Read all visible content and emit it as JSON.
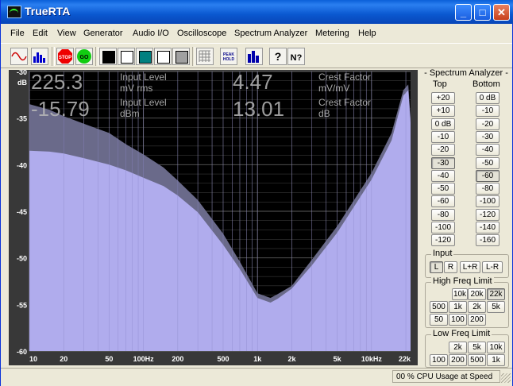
{
  "window": {
    "title": "TrueRTA"
  },
  "menu": [
    "File",
    "Edit",
    "View",
    "Generator",
    "Audio I/O",
    "Oscilloscope",
    "Spectrum Analyzer",
    "Metering",
    "Help"
  ],
  "toolbar": {
    "icons": [
      "sine-wave-icon",
      "spectrum-icon",
      "stop-icon",
      "go-icon",
      "black-swatch-icon",
      "white-swatch-icon",
      "teal-swatch-icon",
      "white-swatch-2-icon",
      "gray-swatch-icon",
      "grid-icon",
      "peak-hold-icon",
      "bars-icon",
      "help-icon",
      "context-help-icon"
    ],
    "stop_label": "STOP",
    "go_label": "GO",
    "peak_label_1": "PEAK",
    "peak_label_2": "HOLD",
    "help_label": "?",
    "context_help_label": "N?",
    "swatch_colors": [
      "#000000",
      "#ffffff",
      "#008080",
      "#ffffff",
      "#a0a0a0"
    ]
  },
  "readouts": {
    "input_level_mv": "225.3",
    "input_level_label1": "Input Level",
    "input_level_unit1": "mV rms",
    "input_level_dbm": "-15.79",
    "input_level_label2": "Input Level",
    "input_level_unit2": "dBm",
    "crest_ratio": "4.47",
    "crest_label1": "Crest Factor",
    "crest_unit1": "mV/mV",
    "crest_db": "13.01",
    "crest_label2": "Crest Factor",
    "crest_unit2": "dB"
  },
  "chart_data": {
    "type": "area",
    "title": "",
    "xlabel": "",
    "ylabel": "dB",
    "x_scale": "log",
    "xlim": [
      10,
      22000
    ],
    "ylim": [
      -60,
      -30
    ],
    "x_ticks": [
      "10",
      "20",
      "50",
      "100Hz",
      "200",
      "500",
      "1k",
      "2k",
      "5k",
      "10kHz",
      "22k"
    ],
    "x_tick_values": [
      10,
      20,
      50,
      100,
      200,
      500,
      1000,
      2000,
      5000,
      10000,
      22000
    ],
    "y_ticks": [
      "-30",
      "-35",
      "-40",
      "-45",
      "-50",
      "-55",
      "-60"
    ],
    "y_tick_values": [
      -30,
      -35,
      -40,
      -45,
      -50,
      -55,
      -60
    ],
    "series": [
      {
        "name": "",
        "color": "#b4b0f2",
        "x": [
          10,
          15,
          20,
          30,
          50,
          70,
          100,
          150,
          200,
          300,
          500,
          700,
          1000,
          1300,
          1500,
          2000,
          3000,
          5000,
          10000,
          15000,
          19000,
          21000,
          22000
        ],
        "y": [
          -38.5,
          -38.6,
          -38.8,
          -39.3,
          -40.0,
          -40.6,
          -41.4,
          -42.3,
          -43.3,
          -45.1,
          -48.6,
          -51.2,
          -54.3,
          -54.8,
          -54.4,
          -53.3,
          -50.8,
          -47.3,
          -41.6,
          -37.4,
          -32.6,
          -32.0,
          -35.5
        ]
      },
      {
        "name": "",
        "color": "#6a6a8a",
        "x": [
          10,
          15,
          20,
          30,
          50,
          70,
          100,
          150,
          200,
          300,
          500,
          700,
          1000,
          1300,
          1500,
          2000,
          3000,
          5000,
          10000,
          15000,
          19000,
          21000,
          22000
        ],
        "y": [
          -33.5,
          -34.1,
          -34.8,
          -35.6,
          -36.6,
          -37.8,
          -38.9,
          -40.3,
          -41.7,
          -43.8,
          -47.4,
          -50.4,
          -53.8,
          -54.3,
          -53.9,
          -53.0,
          -50.2,
          -46.6,
          -40.9,
          -36.6,
          -32.0,
          -31.4,
          -35.0
        ]
      }
    ],
    "grid": true,
    "background": "#000000",
    "grid_color": "#808080"
  },
  "right_panel": {
    "title": "- Spectrum Analyzer -",
    "top_label": "Top",
    "bottom_label": "Bottom",
    "top_buttons": [
      "+20",
      "+10",
      "0 dB",
      "-10",
      "-20",
      "-30",
      "-40",
      "-50",
      "-60",
      "-80",
      "-100",
      "-120"
    ],
    "top_selected": "-30",
    "bottom_buttons": [
      "0 dB",
      "-10",
      "-20",
      "-30",
      "-40",
      "-50",
      "-60",
      "-80",
      "-100",
      "-120",
      "-140",
      "-160"
    ],
    "bottom_selected": "-60",
    "input_label": "Input",
    "input_buttons": [
      "L",
      "R",
      "L+R",
      "L-R"
    ],
    "input_selected": "L",
    "high_freq_label": "High Freq Limit",
    "high_freq_rows": [
      [
        "10k",
        "20k",
        "22k"
      ],
      [
        "500",
        "1k",
        "2k",
        "5k"
      ],
      [
        "50",
        "100",
        "200"
      ]
    ],
    "high_freq_selected": "22k",
    "low_freq_label": "Low Freq Limit",
    "low_freq_rows": [
      [
        "2k",
        "5k",
        "10k"
      ],
      [
        "100",
        "200",
        "500",
        "1k"
      ]
    ]
  },
  "status": {
    "text": "00 % CPU Usage at Speed"
  }
}
